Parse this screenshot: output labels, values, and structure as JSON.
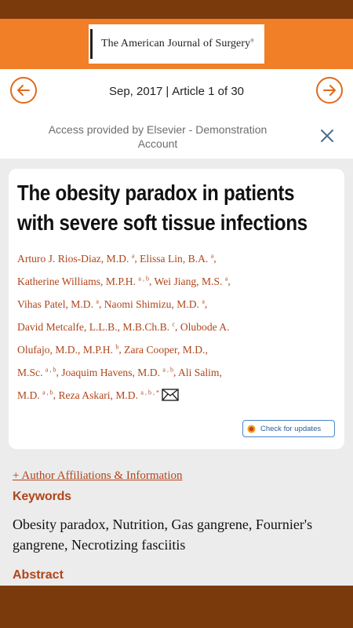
{
  "journal": {
    "name": "The American Journal of Surgery",
    "mark": "®"
  },
  "nav": {
    "date": "Sep, 2017",
    "separator": "|",
    "position": "Article 1 of 30",
    "prev_icon": "arrow-left-circle",
    "next_icon": "arrow-right-circle"
  },
  "access": {
    "text": "Access provided by Elsevier - Demonstration Account",
    "close_icon": "close-x"
  },
  "article": {
    "title": "The obesity paradox in patients with severe soft tissue infections",
    "authors": [
      {
        "name": "Arturo J. Rios-Diaz, M.D.",
        "sup": "a"
      },
      {
        "name": "Elissa Lin, B.A.",
        "sup": "a"
      },
      {
        "name": "Katherine Williams, M.P.H.",
        "sup": "a , b"
      },
      {
        "name": "Wei Jiang, M.S.",
        "sup": "a"
      },
      {
        "name": "Vihas Patel, M.D.",
        "sup": "a"
      },
      {
        "name": "Naomi Shimizu, M.D.",
        "sup": "a"
      },
      {
        "name": "David Metcalfe, L.L.B., M.B.Ch.B.",
        "sup": "c"
      },
      {
        "name": "Olubode A. Olufajo, M.D., M.P.H.",
        "sup": "b"
      },
      {
        "name": "Zara Cooper, M.D., M.Sc.",
        "sup": "a , b"
      },
      {
        "name": "Joaquim Havens, M.D.",
        "sup": "a , b"
      },
      {
        "name": "Ali Salim, M.D.",
        "sup": "a , b"
      },
      {
        "name": "Reza Askari, M.D.",
        "sup": "a , b , *"
      }
    ],
    "check_updates": "Check for updates"
  },
  "affiliations_link": "+ Author Affiliations & Information",
  "keywords": {
    "heading": "Keywords",
    "text": "Obesity paradox, Nutrition, Gas gangrene, Fournier's gangrene, Necrotizing fasciitis"
  },
  "abstract": {
    "heading": "Abstract"
  },
  "colors": {
    "accent": "#e06a1a",
    "header": "#f07f27",
    "dark_brown": "#7a3a0c",
    "link": "#b0451a"
  }
}
